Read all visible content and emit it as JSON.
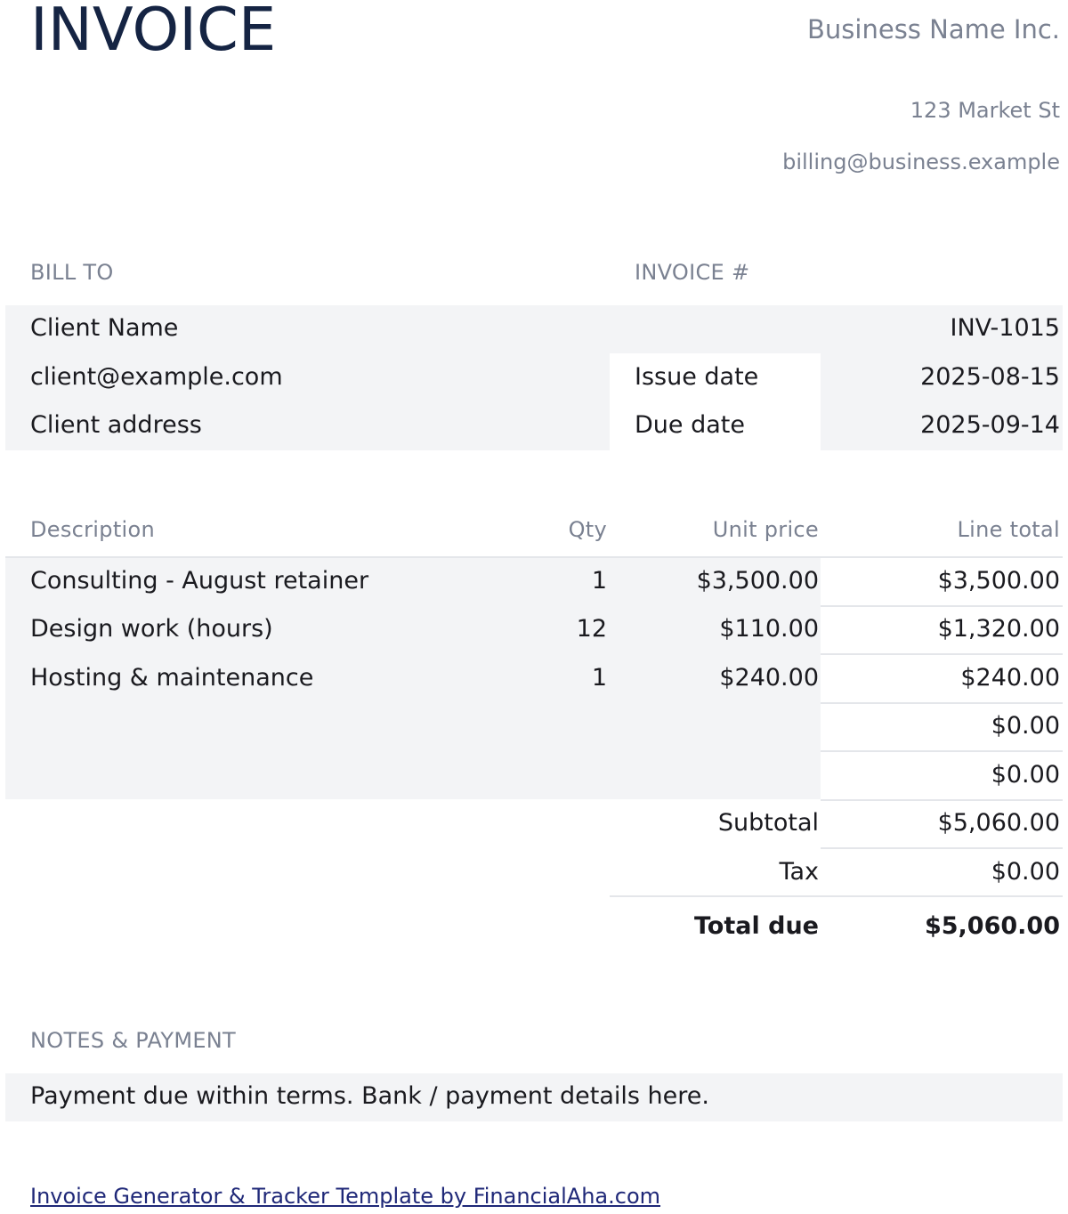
{
  "header": {
    "title": "INVOICE",
    "business_name": "Business Name Inc.",
    "business_address": "123 Market St",
    "business_email": "billing@business.example"
  },
  "bill_to": {
    "label": "BILL TO",
    "client_name": "Client Name",
    "client_email": "client@example.com",
    "client_address": "Client address"
  },
  "invoice_info": {
    "label": "INVOICE #",
    "number": "INV-1015",
    "issue_date_label": "Issue date",
    "issue_date": "2025-08-15",
    "due_date_label": "Due date",
    "due_date": "2025-09-14"
  },
  "items": {
    "headers": {
      "description": "Description",
      "qty": "Qty",
      "unit_price": "Unit price",
      "line_total": "Line total"
    },
    "rows": [
      {
        "description": "Consulting - August retainer",
        "qty": "1",
        "unit_price": "$3,500.00",
        "line_total": "$3,500.00"
      },
      {
        "description": "Design work (hours)",
        "qty": "12",
        "unit_price": "$110.00",
        "line_total": "$1,320.00"
      },
      {
        "description": "Hosting & maintenance",
        "qty": "1",
        "unit_price": "$240.00",
        "line_total": "$240.00"
      },
      {
        "description": "",
        "qty": "",
        "unit_price": "",
        "line_total": "$0.00"
      },
      {
        "description": "",
        "qty": "",
        "unit_price": "",
        "line_total": "$0.00"
      }
    ]
  },
  "totals": {
    "subtotal_label": "Subtotal",
    "subtotal": "$5,060.00",
    "tax_label": "Tax",
    "tax": "$0.00",
    "total_label": "Total due",
    "total": "$5,060.00"
  },
  "notes": {
    "label": "NOTES & PAYMENT",
    "text": "Payment due within terms. Bank / payment details here."
  },
  "footer": {
    "link_text": "Invoice Generator & Tracker Template by FinancialAha.com"
  },
  "colors": {
    "title": "#152443",
    "muted": "#7a8191",
    "shaded_cell": "#f3f4f6",
    "link": "#1f2878"
  }
}
